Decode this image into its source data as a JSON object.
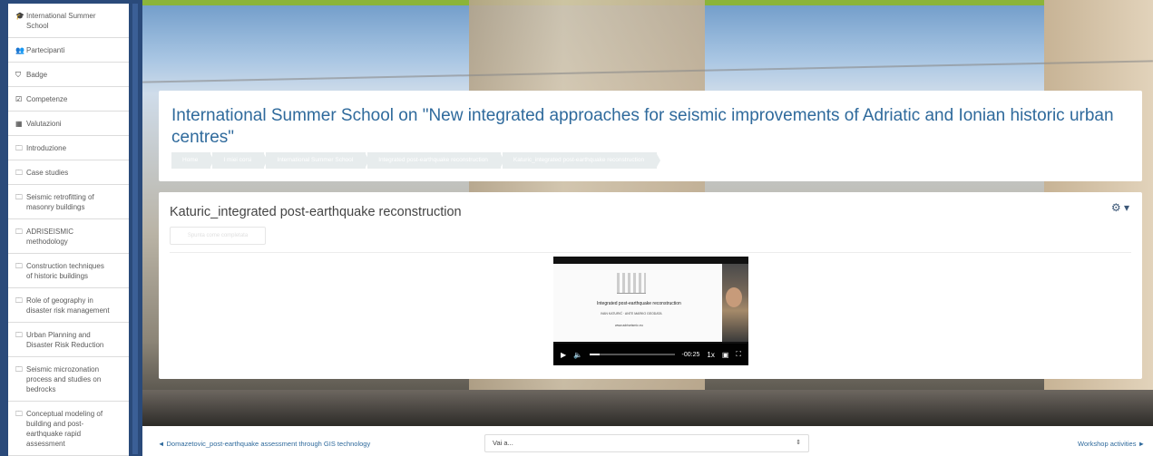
{
  "sidebar": {
    "items": [
      {
        "icon": "graduation-cap-icon",
        "glyph": "🎓",
        "line1": "International Summer",
        "line2": "School"
      },
      {
        "icon": "users-icon",
        "glyph": "👥",
        "line1": "Partecipanti",
        "line2": ""
      },
      {
        "icon": "shield-icon",
        "glyph": "⛉",
        "line1": "Badge",
        "line2": ""
      },
      {
        "icon": "check-square-icon",
        "glyph": "☑",
        "line1": "Competenze",
        "line2": ""
      },
      {
        "icon": "table-icon",
        "glyph": "▦",
        "line1": "Valutazioni",
        "line2": ""
      },
      {
        "icon": "folder-icon",
        "glyph": "🗀",
        "line1": "Introduzione",
        "line2": ""
      },
      {
        "icon": "folder-icon",
        "glyph": "🗀",
        "line1": "Case studies",
        "line2": ""
      },
      {
        "icon": "folder-icon",
        "glyph": "🗀",
        "line1": "Seismic retrofitting of",
        "line2": "masonry buildings"
      },
      {
        "icon": "folder-icon",
        "glyph": "🗀",
        "line1": "ADRISEISMIC",
        "line2": "methodology"
      },
      {
        "icon": "folder-icon",
        "glyph": "🗀",
        "line1": "Construction techniques",
        "line2": "of historic buildings"
      },
      {
        "icon": "folder-icon",
        "glyph": "🗀",
        "line1": "Role of geography in",
        "line2": "disaster risk management"
      },
      {
        "icon": "folder-icon",
        "glyph": "🗀",
        "line1": "Urban Planning and",
        "line2": "Disaster Risk Reduction"
      },
      {
        "icon": "folder-icon",
        "glyph": "🗀",
        "line1": "Seismic microzonation",
        "line2": "process and studies on"
      },
      {
        "icon": "folder-icon",
        "glyph": "🗀",
        "line1": "Conceptual modeling of",
        "line2": "building and post-"
      }
    ],
    "extra_lines": {
      "item12_line3": "bedrocks",
      "item13_line3": "earthquake rapid",
      "item13_line4": "assessment"
    }
  },
  "header": {
    "title": "International Summer School on \"New integrated approaches for seismic improvements of Adriatic and Ionian historic urban centres\"",
    "breadcrumb": [
      "Home",
      "I miei corsi",
      "International Summer School",
      "Integrated post-earthquake reconstruction",
      "Katuric_integrated post-earthquake reconstruction"
    ]
  },
  "activity": {
    "title": "Katuric_integrated post-earthquake reconstruction",
    "done_button": "Spunta come completata",
    "gear_caret": "▾"
  },
  "video": {
    "slide_title": "Integrated post-earthquake reconstruction",
    "slide_sub": "IVAN KATURIĆ · ANTE MARKO GEODATA",
    "slide_sub2": "www.adriseismic.eu",
    "time": "-00:25",
    "rate": "1x",
    "progress": 0.12,
    "play_glyph": "▶",
    "volume_glyph": "🔈",
    "pip_glyph": "▣",
    "fullscreen_glyph": "⛶"
  },
  "footer": {
    "prev_link": "◄ Domazetovic_post-earthquake assessment through GIS technology",
    "jump_label": "Vai a...",
    "jump_caret": "⇕",
    "next_link": "Workshop activities ►"
  }
}
